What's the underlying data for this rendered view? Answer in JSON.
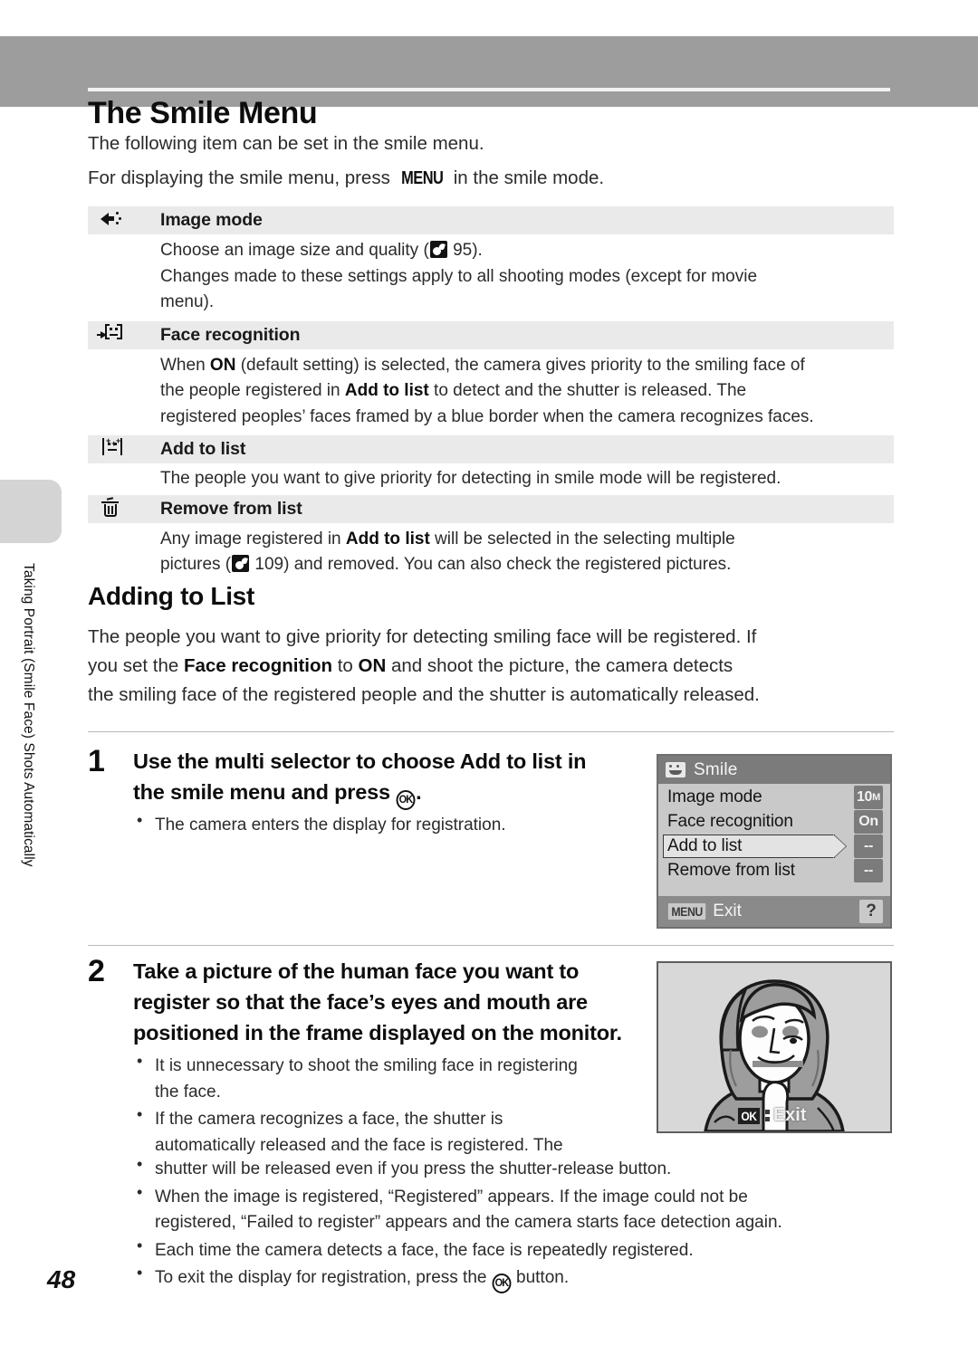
{
  "header": {
    "chapter_title": "The Smile Menu"
  },
  "side_tab": {
    "text": "Taking Portrait (Smile Face) Shots Automatically"
  },
  "intro": {
    "line1": "The following item can be set in the smile menu.",
    "line2_before": "For displaying the smile menu, press ",
    "menu_key": "MENU",
    "line2_after": " in the smile mode."
  },
  "menu_items": [
    {
      "icon": "image-mode-icon",
      "label": "Image mode",
      "desc_line1_before": "Choose an image size and quality (",
      "desc_line1_ref": "95",
      "desc_line1_after": ").",
      "desc_line2": "Changes made to these settings apply to all shooting modes (except for movie",
      "desc_line3": "menu)."
    },
    {
      "icon": "face-recognition-icon",
      "label": "Face recognition",
      "desc_l1_a": "When ",
      "desc_l1_b": "ON",
      "desc_l1_c": " (default setting) is selected, the camera gives priority to the smiling face of",
      "desc_l2_a": "the people registered in ",
      "desc_l2_b": "Add to list",
      "desc_l2_c": " to detect and the shutter is released. The",
      "desc_l3": "registered peoples’ faces framed by a blue border when the camera recognizes faces."
    },
    {
      "icon": "add-to-list-icon",
      "label": "Add to list",
      "desc_l1": "The people you want to give priority for detecting in smile mode will be registered."
    },
    {
      "icon": "trash-icon",
      "label": "Remove from list",
      "desc_l1_a": "Any image registered in ",
      "desc_l1_b": "Add to list",
      "desc_l1_c": " will be selected in the selecting multiple",
      "desc_l2_a": "pictures (",
      "desc_l2_ref": "109",
      "desc_l2_c": ") and removed. You can also check the registered pictures."
    }
  ],
  "section": {
    "heading": "Adding to List",
    "p_l1": "The people you want to give priority for detecting smiling face will be registered. If",
    "p_l2_a": "you set the ",
    "p_l2_b": "Face recognition",
    "p_l2_c": " to ",
    "p_l2_d": "ON",
    "p_l2_e": " and shoot the picture, the camera detects",
    "p_l3": "the smiling face of the registered people and the shutter is automatically released."
  },
  "steps": [
    {
      "number": "1",
      "title_a": "Use the multi selector to choose ",
      "title_b": "Add to list",
      "title_c": " in",
      "title_d": "the smile menu and press ",
      "title_ok": "OK",
      "title_e": ".",
      "bullets": [
        "The camera enters the display for registration."
      ]
    },
    {
      "number": "2",
      "title_l1": "Take a picture of the human face you want to",
      "title_l2": "register so that the face’s eyes and mouth are",
      "title_l3": "positioned in the frame displayed on the monitor.",
      "bullets": [
        {
          "l1": "It is unnecessary to shoot the smiling face in registering",
          "l2": "the face."
        },
        {
          "l1": "If the camera recognizes a face, the shutter is",
          "l2": "automatically released and the face is registered. The",
          "l3": "shutter will be released even if you press the shutter-release button."
        },
        {
          "l1": "When the image is registered, “Registered” appears. If the image could not be",
          "l2": "registered, “Failed to register” appears and the camera starts face detection again."
        },
        {
          "l1": "Each time the camera detects a face, the face is repeatedly registered."
        },
        {
          "l1_a": "To exit the display for registration, press the ",
          "l1_ok": "OK",
          "l1_c": " button."
        }
      ]
    }
  ],
  "lcd_screen": {
    "title": "Smile",
    "title_icon": "smile-face-icon",
    "items": [
      {
        "label": "Image mode",
        "badge": "10",
        "badge_sub": "M",
        "selected": false
      },
      {
        "label": "Face recognition",
        "badge": "On",
        "badge_sub": "",
        "selected": false
      },
      {
        "label": "Add to list",
        "badge": "--",
        "badge_sub": "",
        "selected": true
      },
      {
        "label": "Remove from list",
        "badge": "--",
        "badge_sub": "",
        "selected": false
      }
    ],
    "bottom_menu_key": "MENU",
    "bottom_exit": "Exit",
    "help_icon": "?"
  },
  "photo": {
    "ok_chip": "OK",
    "exit_label": "Exit",
    "alt": "illustration of a woman's face framed in the monitor"
  },
  "page_number": "48",
  "colors": {
    "header_band": "#9d9d9d",
    "row_header_bg": "#eaeaea",
    "lcd_title_bar": "#7b7b7b",
    "lcd_body": "#c9c9c9",
    "side_tab": "#d4d4d4"
  }
}
